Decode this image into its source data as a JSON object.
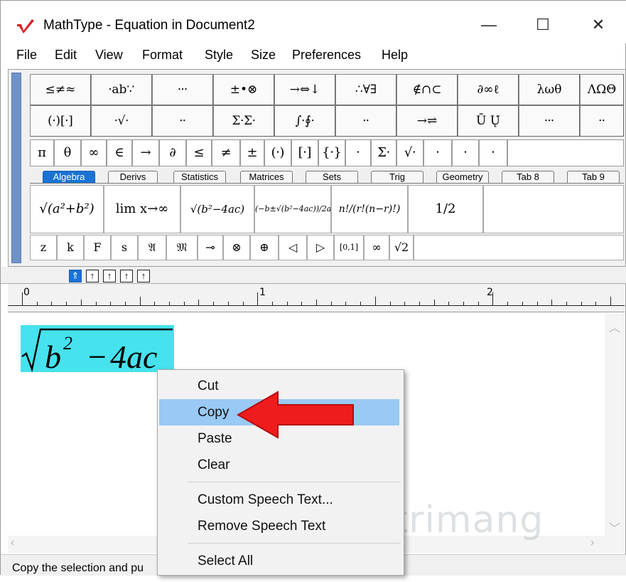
{
  "window": {
    "title": "MathType - Equation in Document2",
    "controls": {
      "minimize": "—",
      "maximize": "☐",
      "close": "✕"
    },
    "accent_color": "#e11b22"
  },
  "menu": [
    "File",
    "Edit",
    "View",
    "Format",
    "Style",
    "Size",
    "Preferences",
    "Help"
  ],
  "palette": {
    "row1": [
      "≤≠≈",
      "⸱ab∵",
      "⸱⸱⸱",
      "±•⊗",
      "→⇔↓",
      "∴∀∃",
      "∉∩⊂",
      "∂∞ℓ",
      "λωθ",
      "ΛΩΘ"
    ],
    "row2": [
      "(⸱)[⸱]",
      "⸱√⸱",
      "⸱⸱",
      "Σ⸱Σ⸱",
      "∫⸱∮⸱",
      "⸱⸱",
      "→⇌",
      "Ū Ų̇",
      "⸱⸱⸱",
      "⸱⸱"
    ],
    "row3": [
      "π",
      "θ",
      "∞",
      "∈",
      "→",
      "∂",
      "≤",
      "≠",
      "±",
      "(⸱)",
      "[⸱]",
      "{⸱}",
      "⸱",
      "Σ⸱",
      "√⸱",
      "⸱",
      "⸱",
      "⸱"
    ],
    "tabs": [
      "Algebra",
      "Derivs",
      "Statistics",
      "Matrices",
      "Sets",
      "Trig",
      "Geometry",
      "Tab 8",
      "Tab 9"
    ],
    "active_tab": "Algebra",
    "row4": [
      "√(a²+b²)",
      "lim x→∞",
      "√(b²−4ac)",
      "(−b±√(b²−4ac))/2a",
      "n!/(r!(n−r)!)",
      "1/2"
    ],
    "row5": [
      "z",
      "k",
      "F",
      "s",
      "𝔄",
      "𝔐",
      "⊸",
      "⊗",
      "⊕",
      "◁",
      "▷",
      "[0,1]",
      "∞",
      "√2"
    ]
  },
  "size_buttons": [
    "⇑",
    "↑",
    "↑",
    "↑",
    "↑"
  ],
  "ruler": {
    "labels": [
      "0",
      "1",
      "2"
    ]
  },
  "equation": {
    "text": "√b² − 4ac",
    "highlight": "#46e2ee"
  },
  "context_menu": {
    "items": [
      "Cut",
      "Copy",
      "Paste",
      "Clear",
      "Custom Speech Text...",
      "Remove Speech Text",
      "Select All"
    ],
    "highlighted": "Copy",
    "highlight_color": "#99c9f5"
  },
  "status": "Copy the selection and pu",
  "watermark": "Quantrimang"
}
